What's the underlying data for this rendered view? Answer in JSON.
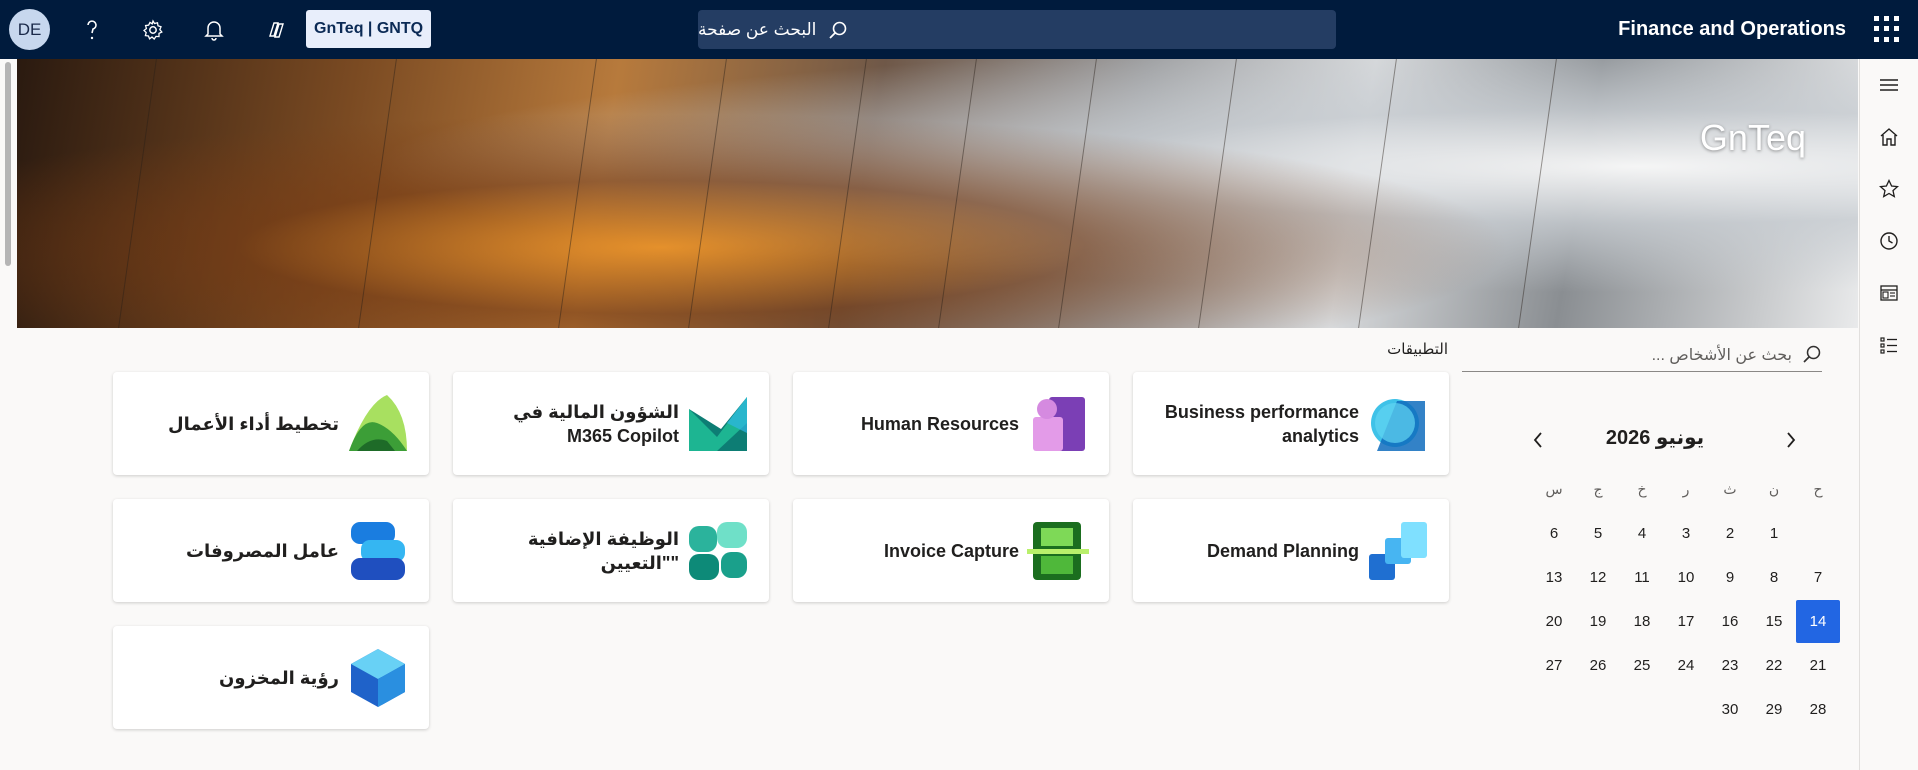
{
  "topbar": {
    "avatar_initials": "DE",
    "company": "GnTeq | GNTQ",
    "search_placeholder": "البحث عن صفحة",
    "app_title": "Finance and Operations"
  },
  "banner": {
    "title": "GnTeq"
  },
  "people_search": {
    "placeholder": "بحث عن الأشخاص ..."
  },
  "apps_section_label": "التطبيقات",
  "tiles": [
    {
      "label": "Business performance analytics"
    },
    {
      "label": "Human Resources"
    },
    {
      "label": "الشؤون المالية في M365 Copilot"
    },
    {
      "label": "تخطيط أداء الأعمال"
    },
    {
      "label": "Demand Planning"
    },
    {
      "label": "Invoice Capture"
    },
    {
      "label": "الوظيفة الإضافية \"التعيين\""
    },
    {
      "label": "عامل المصروفات"
    },
    {
      "label": "رؤية المخزون"
    }
  ],
  "calendar": {
    "month_label": "يونيو  2026",
    "weekdays": [
      "ح",
      "ن",
      "ث",
      "ر",
      "خ",
      "ج",
      "س"
    ],
    "weeks": [
      [
        "",
        "1",
        "2",
        "3",
        "4",
        "5",
        "6"
      ],
      [
        "7",
        "8",
        "9",
        "10",
        "11",
        "12",
        "13"
      ],
      [
        "14",
        "15",
        "16",
        "17",
        "18",
        "19",
        "20"
      ],
      [
        "21",
        "22",
        "23",
        "24",
        "25",
        "26",
        "27"
      ],
      [
        "28",
        "29",
        "30",
        "",
        "",
        "",
        ""
      ]
    ],
    "today": "14"
  },
  "colors": {
    "topbar": "#001b3d",
    "accent": "#2266e3"
  }
}
